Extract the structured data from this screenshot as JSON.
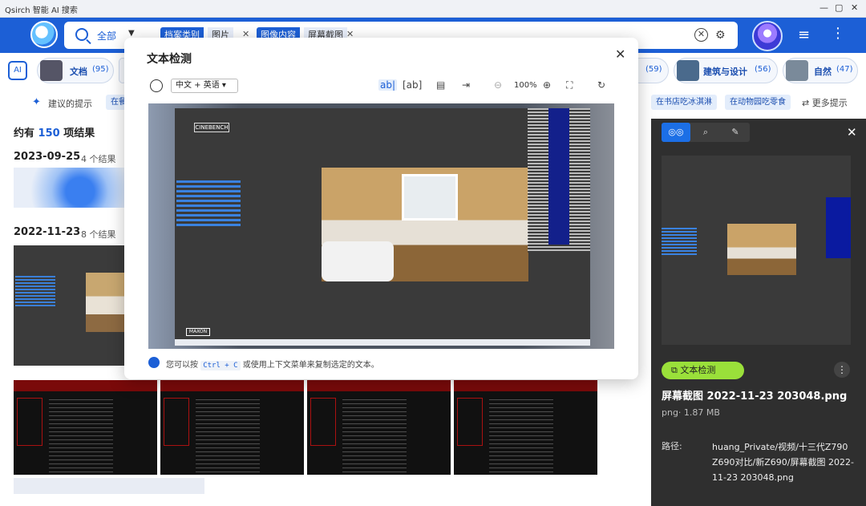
{
  "window": {
    "title": "Qsirch 智能 AI 搜索"
  },
  "search": {
    "scope": "全部",
    "chips": [
      {
        "key": "档案类别",
        "value": "图片"
      },
      {
        "key": "图像内容",
        "value": "屏幕截图"
      }
    ]
  },
  "categories": [
    {
      "name": "文档",
      "count": "(95)"
    },
    {
      "name": "建筑与设计",
      "count": "(56)"
    },
    {
      "name": "自然",
      "count": "(47)"
    },
    {
      "partial_count": "(59)"
    }
  ],
  "suggestions": {
    "label": "建议的提示",
    "items": [
      "在餐",
      "在书店吃冰淇淋",
      "在动物园吃零食"
    ],
    "more": "更多提示"
  },
  "results": {
    "prefix": "约有",
    "count": "150",
    "suffix": "项结果",
    "groups": [
      {
        "date": "2023-09-25",
        "count": "4 个结果"
      },
      {
        "date": "2022-11-23",
        "count": "8 个结果"
      }
    ]
  },
  "modal": {
    "title": "文本检测",
    "language": "中文 + 英语",
    "zoom": "100%",
    "preview_text": {
      "cinebench": "CINEBENCH",
      "maxon": "MAXON"
    },
    "hint_before": "您可以按",
    "hint_key": "Ctrl + C",
    "hint_after": "或使用上下文菜单来复制选定的文本。"
  },
  "detail": {
    "ocr_button": "文本检测",
    "filename": "屏幕截图 2022-11-23 203048.png",
    "meta": "png· 1.87 MB",
    "path_label": "路径:",
    "path": "huang_Private/视频/十三代Z790 Z690对比/新Z690/屏幕截图 2022-11-23 203048.png"
  },
  "icons": {
    "search": "search-icon",
    "close": "close-icon",
    "settings": "sliders-icon"
  },
  "colors": {
    "brand": "#1c5fd6",
    "ocr_button": "#9ae03a",
    "panel_bg": "#2f2f2f"
  }
}
